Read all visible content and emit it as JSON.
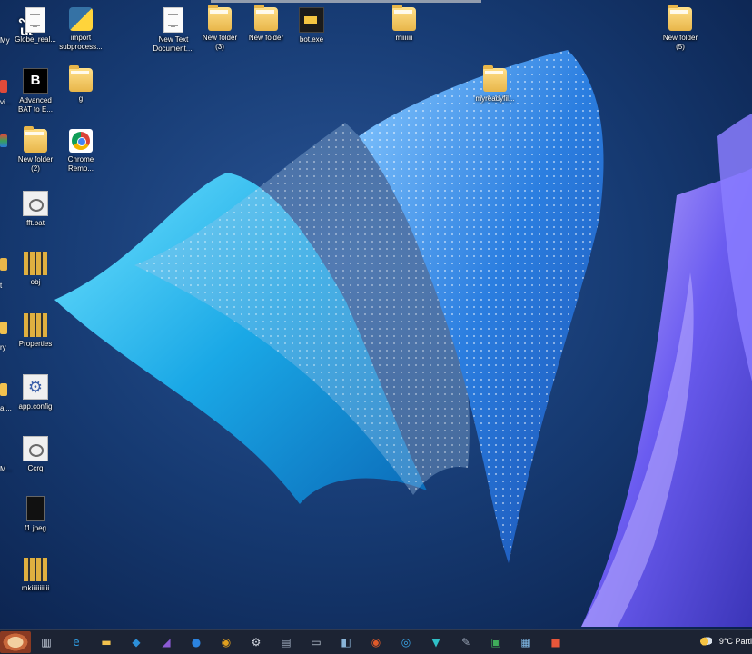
{
  "desktop": {
    "brand_text": "ut",
    "icons": [
      {
        "id": "globe",
        "label": "Globe_real...",
        "type": "doc"
      },
      {
        "id": "import-subprocess",
        "label": "import\nsubprocess...",
        "type": "py"
      },
      {
        "id": "new-text-document",
        "label": "New Text\nDocument....",
        "type": "doc"
      },
      {
        "id": "new-folder-3",
        "label": "New folder\n(3)",
        "type": "folder"
      },
      {
        "id": "new-folder",
        "label": "New folder",
        "type": "folder"
      },
      {
        "id": "bot-exe",
        "label": "bot.exe",
        "type": "exe"
      },
      {
        "id": "miiiiiii",
        "label": "miiiiiii",
        "type": "folder"
      },
      {
        "id": "new-folder-5",
        "label": "New folder\n(5)",
        "type": "folder"
      },
      {
        "id": "advanced-bat",
        "label": "Advanced\nBAT to E...",
        "type": "bat"
      },
      {
        "id": "g",
        "label": "g",
        "type": "folder"
      },
      {
        "id": "myreadyfile",
        "label": "myreadyfil...",
        "type": "folder"
      },
      {
        "id": "new-folder-2",
        "label": "New folder\n(2)",
        "type": "folder"
      },
      {
        "id": "chrome-remote",
        "label": "Chrome\nRemo...",
        "type": "chrome"
      },
      {
        "id": "fft-bat",
        "label": "fft.bat",
        "type": "batf"
      },
      {
        "id": "obj",
        "label": "obj",
        "type": "zip"
      },
      {
        "id": "properties",
        "label": "Properties",
        "type": "zip"
      },
      {
        "id": "app-config",
        "label": "app.config",
        "type": "gear"
      },
      {
        "id": "ccrq",
        "label": "Ccrq",
        "type": "batf"
      },
      {
        "id": "f1-jpeg",
        "label": "f1.jpeg",
        "type": "jpeg"
      },
      {
        "id": "mkiiiiiiiiiii",
        "label": "mkiiiiiiiiiii",
        "type": "zip"
      }
    ],
    "partial_labels": [
      "My",
      "vi...",
      "t",
      "ry",
      "al...",
      "M..."
    ]
  },
  "taskbar": {
    "weather_text": "9°C  Partl",
    "buttons": [
      {
        "id": "task-view",
        "glyph": "▥",
        "color": "#cfd8e6"
      },
      {
        "id": "edge",
        "glyph": "e",
        "color": "#2f9be0"
      },
      {
        "id": "file-explorer",
        "glyph": "▬",
        "color": "#f2c14e"
      },
      {
        "id": "vscode",
        "glyph": "◆",
        "color": "#2c8fd9"
      },
      {
        "id": "visual-studio",
        "glyph": "◢",
        "color": "#8c5bd6"
      },
      {
        "id": "chat",
        "glyph": "●",
        "color": "#2b83e0"
      },
      {
        "id": "chrome",
        "glyph": "◉",
        "color": "#e0a020"
      },
      {
        "id": "settings",
        "glyph": "⚙",
        "color": "#d6dbe4"
      },
      {
        "id": "app-a",
        "glyph": "▤",
        "color": "#9aa6b8"
      },
      {
        "id": "terminal",
        "glyph": "▭",
        "color": "#b8c2d0"
      },
      {
        "id": "app-b",
        "glyph": "◧",
        "color": "#8ab4d8"
      },
      {
        "id": "app-c",
        "glyph": "◉",
        "color": "#e05a2a"
      },
      {
        "id": "app-d",
        "glyph": "◎",
        "color": "#3aa6e8"
      },
      {
        "id": "app-e",
        "glyph": "▼",
        "color": "#2fc0c8"
      },
      {
        "id": "app-f",
        "glyph": "✎",
        "color": "#9aa6b8"
      },
      {
        "id": "app-g",
        "glyph": "▣",
        "color": "#3fae5a"
      },
      {
        "id": "app-h",
        "glyph": "▦",
        "color": "#7fb8e6"
      },
      {
        "id": "app-i",
        "glyph": "■",
        "color": "#e8563a"
      }
    ]
  }
}
